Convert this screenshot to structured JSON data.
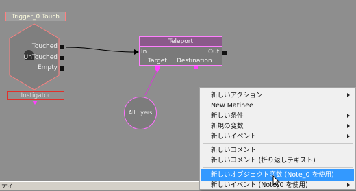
{
  "event_node": {
    "title": "Trigger_0 Touch",
    "outputs": [
      "Touched",
      "UnTouched",
      "Empty"
    ],
    "variable": "Instigator"
  },
  "teleport_node": {
    "title": "Teleport",
    "input": "In",
    "output": "Out",
    "var_links": [
      "Target",
      "Destination"
    ]
  },
  "all_players": {
    "label": "All...yers"
  },
  "context_menu": {
    "items": [
      {
        "label": "新しいアクション",
        "submenu": true
      },
      {
        "label": "New Matinee",
        "submenu": false
      },
      {
        "label": "新しい条件",
        "submenu": true
      },
      {
        "label": "新規の変数",
        "submenu": true
      },
      {
        "label": "新しいイベント",
        "submenu": true
      },
      {
        "label": "新しいコメント",
        "submenu": false
      },
      {
        "label": "新しいコメント (折り返しテキスト)",
        "submenu": false
      },
      {
        "label": "新しいオブジェクト変数 (Note_0 を使用)",
        "submenu": false,
        "highlighted": true
      },
      {
        "label": "新しいイベント (Note_0 を使用)",
        "submenu": true
      }
    ]
  },
  "status": {
    "text": "ティ"
  },
  "colors": {
    "canvas": "#8e8e8e",
    "event_border": "#ff8080",
    "teleport_border": "#ff80ff",
    "menu_highlight": "#3399ff"
  }
}
